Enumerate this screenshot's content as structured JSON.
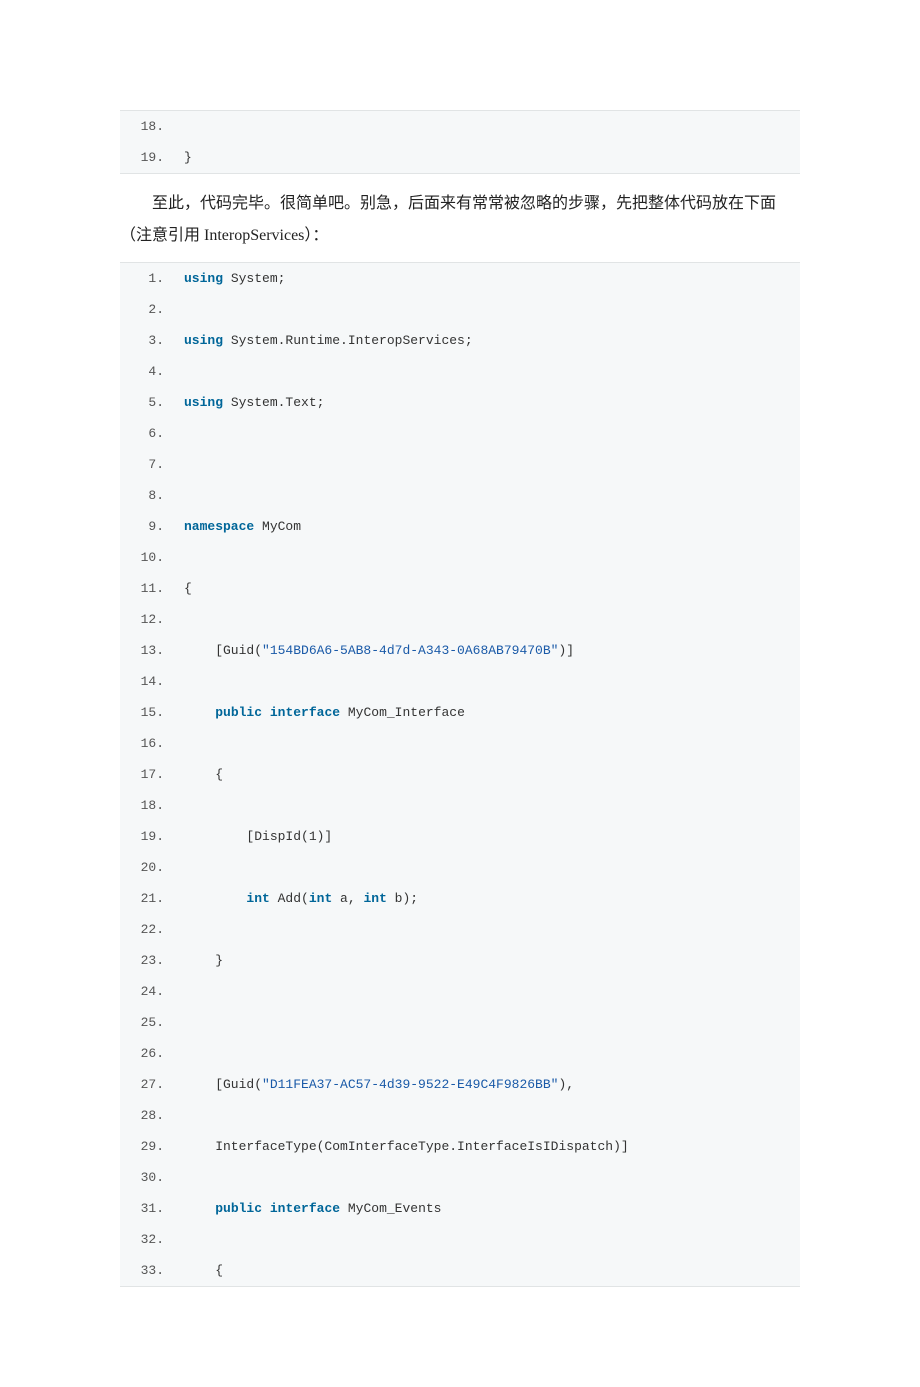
{
  "block1": {
    "lines": [
      {
        "n": "18.",
        "segs": []
      },
      {
        "n": "19.",
        "segs": [
          {
            "t": "}",
            "c": ""
          }
        ]
      }
    ]
  },
  "para1": "至此，代码完毕。很简单吧。别急，后面来有常常被忽略的步骤，先把整体代码放在下面（注意引用 InteropServices）：",
  "block2": {
    "lines": [
      {
        "n": "1.",
        "segs": [
          {
            "t": "using",
            "c": "kw"
          },
          {
            "t": " System;",
            "c": ""
          }
        ]
      },
      {
        "n": "2.",
        "segs": []
      },
      {
        "n": "3.",
        "segs": [
          {
            "t": "using",
            "c": "kw"
          },
          {
            "t": " System.Runtime.InteropServices;",
            "c": ""
          }
        ]
      },
      {
        "n": "4.",
        "segs": []
      },
      {
        "n": "5.",
        "segs": [
          {
            "t": "using",
            "c": "kw"
          },
          {
            "t": " System.Text;",
            "c": ""
          }
        ]
      },
      {
        "n": "6.",
        "segs": []
      },
      {
        "n": "7.",
        "segs": []
      },
      {
        "n": "8.",
        "segs": []
      },
      {
        "n": "9.",
        "segs": [
          {
            "t": "namespace",
            "c": "kw"
          },
          {
            "t": " MyCom",
            "c": ""
          }
        ]
      },
      {
        "n": "10.",
        "segs": []
      },
      {
        "n": "11.",
        "segs": [
          {
            "t": "{",
            "c": ""
          }
        ]
      },
      {
        "n": "12.",
        "segs": []
      },
      {
        "n": "13.",
        "segs": [
          {
            "t": "    [Guid(",
            "c": ""
          },
          {
            "t": "\"154BD6A6-5AB8-4d7d-A343-0A68AB79470B\"",
            "c": "str"
          },
          {
            "t": ")]",
            "c": ""
          }
        ]
      },
      {
        "n": "14.",
        "segs": []
      },
      {
        "n": "15.",
        "segs": [
          {
            "t": "    ",
            "c": ""
          },
          {
            "t": "public",
            "c": "kw"
          },
          {
            "t": " ",
            "c": ""
          },
          {
            "t": "interface",
            "c": "kw"
          },
          {
            "t": " MyCom_Interface",
            "c": ""
          }
        ]
      },
      {
        "n": "16.",
        "segs": []
      },
      {
        "n": "17.",
        "segs": [
          {
            "t": "    {",
            "c": ""
          }
        ]
      },
      {
        "n": "18.",
        "segs": []
      },
      {
        "n": "19.",
        "segs": [
          {
            "t": "        [DispId(1)]",
            "c": ""
          }
        ]
      },
      {
        "n": "20.",
        "segs": []
      },
      {
        "n": "21.",
        "segs": [
          {
            "t": "        ",
            "c": ""
          },
          {
            "t": "int",
            "c": "kw"
          },
          {
            "t": " Add(",
            "c": ""
          },
          {
            "t": "int",
            "c": "kw"
          },
          {
            "t": " a, ",
            "c": ""
          },
          {
            "t": "int",
            "c": "kw"
          },
          {
            "t": " b);",
            "c": ""
          }
        ]
      },
      {
        "n": "22.",
        "segs": []
      },
      {
        "n": "23.",
        "segs": [
          {
            "t": "    }",
            "c": ""
          }
        ]
      },
      {
        "n": "24.",
        "segs": []
      },
      {
        "n": "25.",
        "segs": []
      },
      {
        "n": "26.",
        "segs": []
      },
      {
        "n": "27.",
        "segs": [
          {
            "t": "    [Guid(",
            "c": ""
          },
          {
            "t": "\"D11FEA37-AC57-4d39-9522-E49C4F9826BB\"",
            "c": "str"
          },
          {
            "t": "),",
            "c": ""
          }
        ]
      },
      {
        "n": "28.",
        "segs": []
      },
      {
        "n": "29.",
        "segs": [
          {
            "t": "    InterfaceType(ComInterfaceType.InterfaceIsIDispatch)]",
            "c": ""
          }
        ]
      },
      {
        "n": "30.",
        "segs": []
      },
      {
        "n": "31.",
        "segs": [
          {
            "t": "    ",
            "c": ""
          },
          {
            "t": "public",
            "c": "kw"
          },
          {
            "t": " ",
            "c": ""
          },
          {
            "t": "interface",
            "c": "kw"
          },
          {
            "t": " MyCom_Events",
            "c": ""
          }
        ]
      },
      {
        "n": "32.",
        "segs": []
      },
      {
        "n": "33.",
        "segs": [
          {
            "t": "    {",
            "c": ""
          }
        ]
      }
    ]
  }
}
